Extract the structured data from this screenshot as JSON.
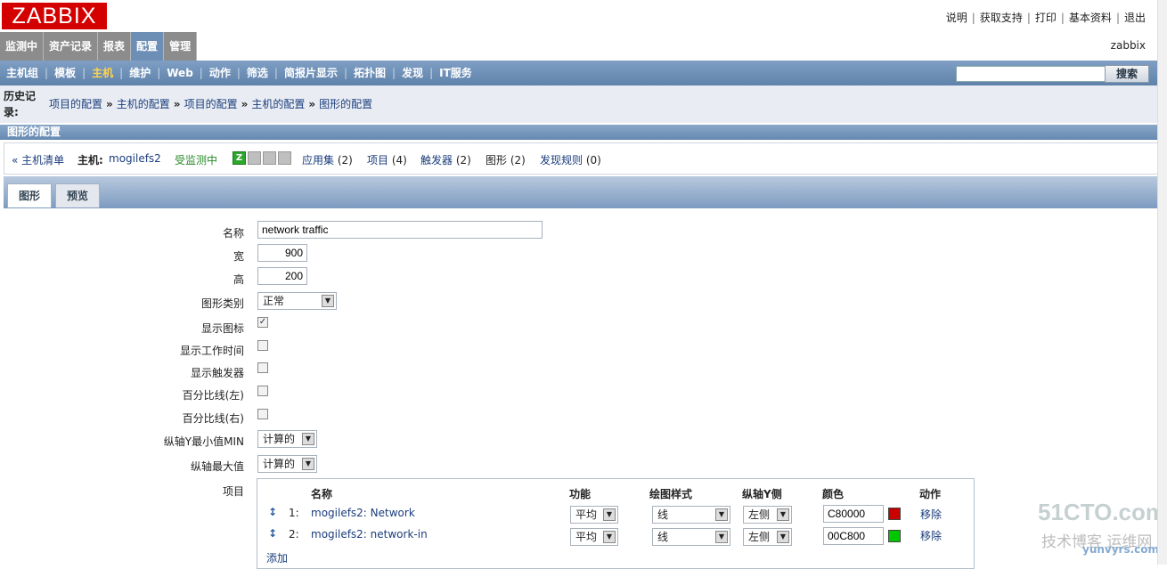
{
  "app": {
    "logo": "ZABBIX",
    "user": "zabbix"
  },
  "toplinks": [
    "说明",
    "获取支持",
    "打印",
    "基本资料",
    "退出"
  ],
  "main_menu": [
    {
      "label": "监测中",
      "active": false
    },
    {
      "label": "资产记录",
      "active": false
    },
    {
      "label": "报表",
      "active": false
    },
    {
      "label": "配置",
      "active": true
    },
    {
      "label": "管理",
      "active": false
    }
  ],
  "sub_menu": [
    {
      "label": "主机组",
      "active": false
    },
    {
      "label": "模板",
      "active": false
    },
    {
      "label": "主机",
      "active": true
    },
    {
      "label": "维护",
      "active": false
    },
    {
      "label": "Web",
      "active": false
    },
    {
      "label": "动作",
      "active": false
    },
    {
      "label": "筛选",
      "active": false
    },
    {
      "label": "简报片显示",
      "active": false
    },
    {
      "label": "拓扑图",
      "active": false
    },
    {
      "label": "发现",
      "active": false
    },
    {
      "label": "IT服务",
      "active": false
    }
  ],
  "search": {
    "value": "",
    "button": "搜索"
  },
  "history": {
    "label": "历史记录:",
    "crumbs": [
      "项目的配置",
      "主机的配置",
      "项目的配置",
      "主机的配置",
      "图形的配置"
    ],
    "separator": "»"
  },
  "section_title": "图形的配置",
  "hostbar": {
    "host_list": "« 主机清单",
    "host_label": "主机:",
    "host_name": "mogilefs2",
    "status": "受监测中",
    "status_icons": [
      "Z",
      "SNMP",
      "JMX",
      "IPMI"
    ],
    "links": [
      {
        "label": "应用集",
        "count": "(2)"
      },
      {
        "label": "项目",
        "count": "(4)"
      },
      {
        "label": "触发器",
        "count": "(2)"
      },
      {
        "label": "图形",
        "count": "(2)"
      },
      {
        "label": "发现规则",
        "count": "(0)"
      }
    ]
  },
  "tabs": [
    {
      "label": "图形",
      "active": true
    },
    {
      "label": "预览",
      "active": false
    }
  ],
  "form": {
    "name_label": "名称",
    "name_value": "network traffic",
    "width_label": "宽",
    "width_value": "900",
    "height_label": "高",
    "height_value": "200",
    "type_label": "图形类别",
    "type_value": "正常",
    "legend_label": "显示图标",
    "legend_checked": true,
    "worktime_label": "显示工作时间",
    "worktime_checked": false,
    "triggers_label": "显示触发器",
    "triggers_checked": false,
    "pleft_label": "百分比线(左)",
    "pleft_checked": false,
    "pright_label": "百分比线(右)",
    "pright_checked": false,
    "ymin_label": "纵轴Y最小值MIN",
    "ymin_value": "计算的",
    "ymax_label": "纵轴最大值",
    "ymax_value": "计算的",
    "items_label": "项目"
  },
  "items_table": {
    "headers": [
      "名称",
      "功能",
      "绘图样式",
      "纵轴Y侧",
      "颜色",
      "动作"
    ],
    "rows": [
      {
        "num": "1:",
        "name": "mogilefs2: Network",
        "func": "平均",
        "style": "线",
        "side": "左侧",
        "color": "C80000",
        "color_hex": "#C80000",
        "action": "移除"
      },
      {
        "num": "2:",
        "name": "mogilefs2: network-in",
        "func": "平均",
        "style": "线",
        "side": "左侧",
        "color": "00C800",
        "color_hex": "#00C800",
        "action": "移除"
      }
    ],
    "add": "添加"
  },
  "watermark": {
    "line1": "51CTO.com",
    "line2": "技术博客",
    "line3": "运维网",
    "line4": "yunvyrs.com"
  },
  "colors": {
    "logo": "#d40000",
    "menu_active": "#6d8fb5",
    "submenu_active": "#ffd24d"
  }
}
